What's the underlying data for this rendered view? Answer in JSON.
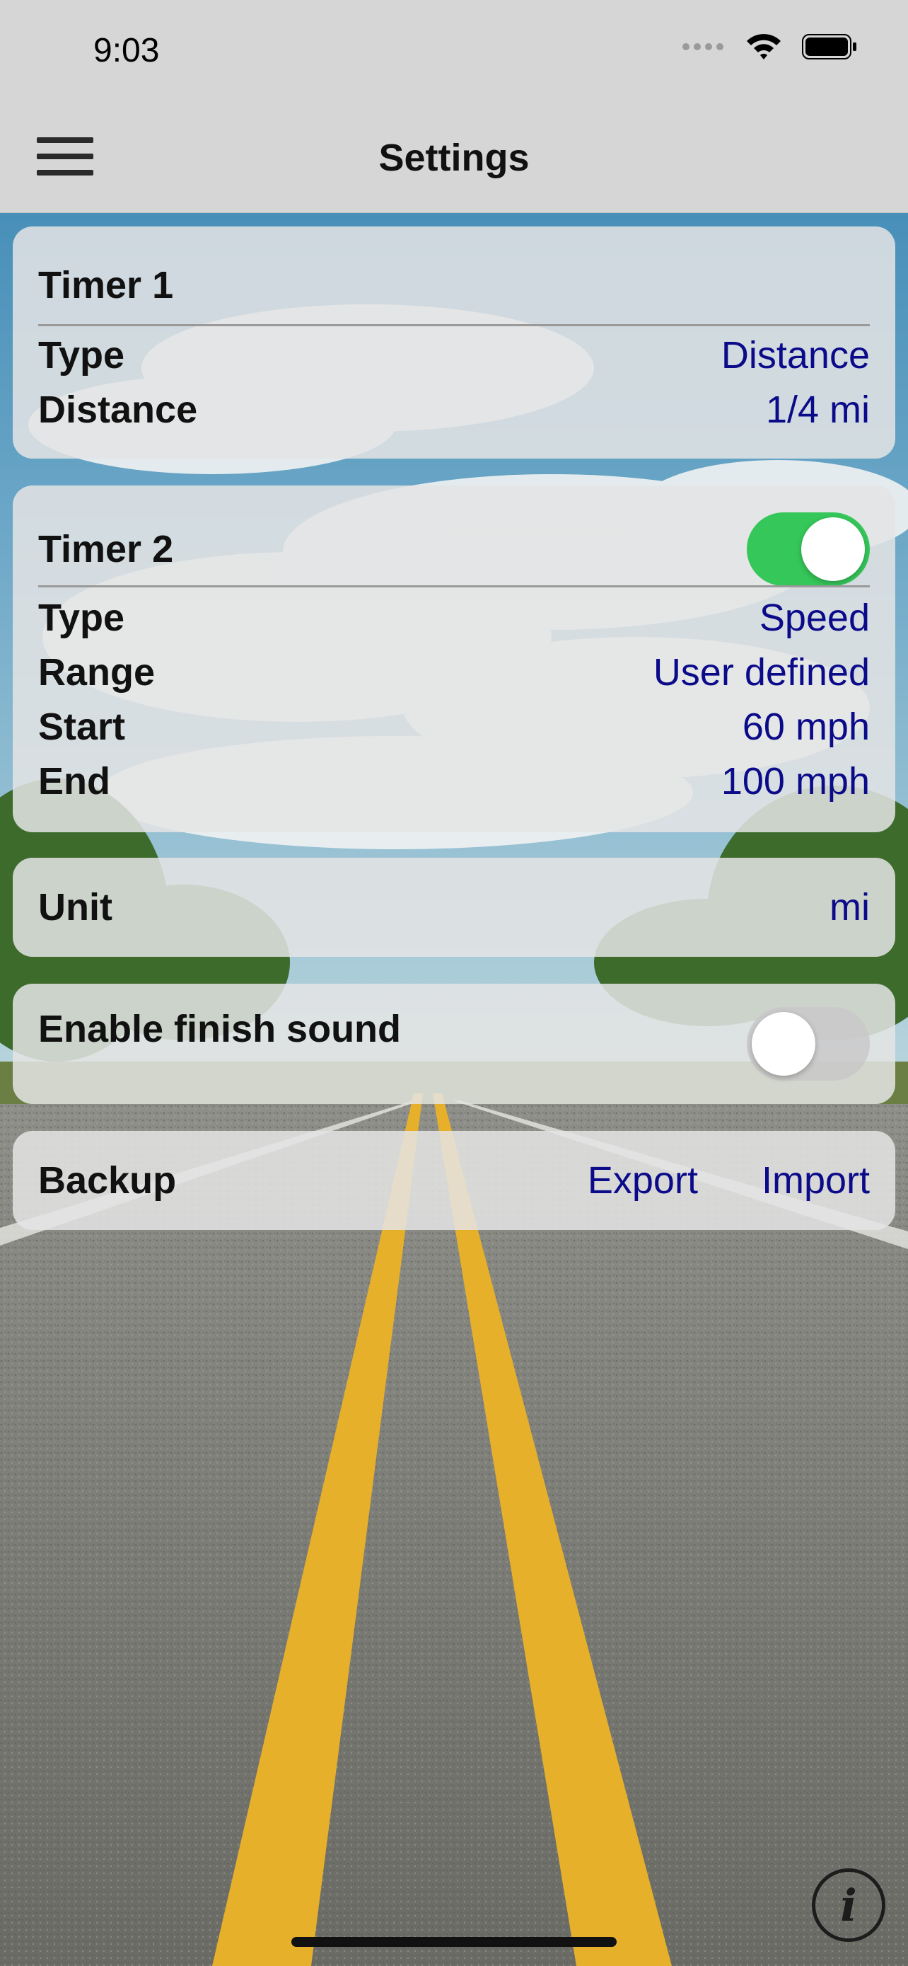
{
  "status_bar": {
    "time": "9:03"
  },
  "nav": {
    "title": "Settings",
    "menu_icon": "hamburger-menu-icon"
  },
  "timer1": {
    "title": "Timer 1",
    "type_label": "Type",
    "type_value": "Distance",
    "distance_label": "Distance",
    "distance_value": "1/4 mi"
  },
  "timer2": {
    "title": "Timer 2",
    "enabled": true,
    "type_label": "Type",
    "type_value": "Speed",
    "range_label": "Range",
    "range_value": "User defined",
    "start_label": "Start",
    "start_value": "60 mph",
    "end_label": "End",
    "end_value": "100 mph"
  },
  "unit": {
    "label": "Unit",
    "value": "mi"
  },
  "finish_sound": {
    "label": "Enable finish sound",
    "enabled": false
  },
  "backup": {
    "label": "Backup",
    "export_label": "Export",
    "import_label": "Import"
  },
  "colors": {
    "accent_text": "#0b0b8a",
    "toggle_on": "#35c759"
  },
  "info_icon": "info-icon"
}
